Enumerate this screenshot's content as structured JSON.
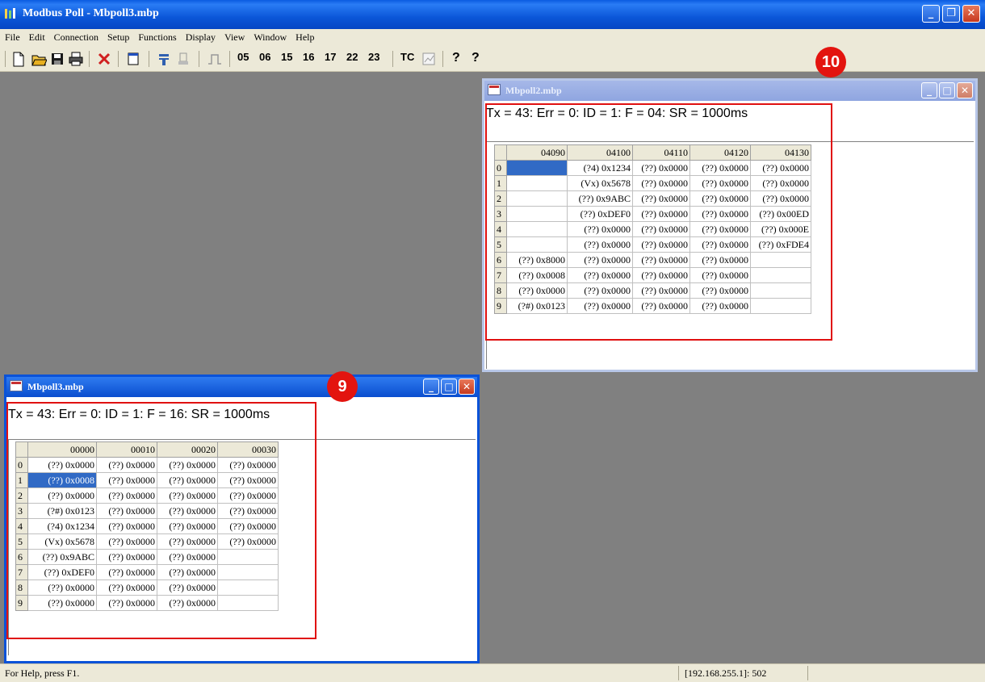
{
  "app": {
    "title": "Modbus Poll - Mbpoll3.mbp",
    "window_buttons": {
      "minimize": "_",
      "restore": "❐",
      "close": "✕"
    }
  },
  "menu": [
    "File",
    "Edit",
    "Connection",
    "Setup",
    "Functions",
    "Display",
    "View",
    "Window",
    "Help"
  ],
  "toolbar": {
    "icons": [
      "new-icon",
      "open-icon",
      "save-icon",
      "print-icon",
      "delete-icon",
      "window-icon",
      "connect-icon",
      "disconnect-icon",
      "pulse-icon"
    ],
    "function_codes": [
      "05",
      "06",
      "15",
      "16",
      "17",
      "22",
      "23"
    ],
    "tc_label": "TC",
    "help_icon": "?",
    "context_help_icon": "?"
  },
  "windows": {
    "mbpoll2": {
      "title": "Mbpoll2.mbp",
      "status": "Tx = 43: Err = 0: ID = 1: F = 04: SR = 1000ms",
      "columns": [
        "04090",
        "04100",
        "04110",
        "04120",
        "04130"
      ],
      "rows": [
        [
          "",
          "(?4) 0x1234",
          "(??) 0x0000",
          "(??) 0x0000",
          "(??) 0x0000"
        ],
        [
          "",
          "(Vx) 0x5678",
          "(??) 0x0000",
          "(??) 0x0000",
          "(??) 0x0000"
        ],
        [
          "",
          "(??) 0x9ABC",
          "(??) 0x0000",
          "(??) 0x0000",
          "(??) 0x0000"
        ],
        [
          "",
          "(??) 0xDEF0",
          "(??) 0x0000",
          "(??) 0x0000",
          "(??) 0x00ED"
        ],
        [
          "",
          "(??) 0x0000",
          "(??) 0x0000",
          "(??) 0x0000",
          "(??) 0x000E"
        ],
        [
          "",
          "(??) 0x0000",
          "(??) 0x0000",
          "(??) 0x0000",
          "(??) 0xFDE4"
        ],
        [
          "(??) 0x8000",
          "(??) 0x0000",
          "(??) 0x0000",
          "(??) 0x0000",
          ""
        ],
        [
          "(??) 0x0008",
          "(??) 0x0000",
          "(??) 0x0000",
          "(??) 0x0000",
          ""
        ],
        [
          "(??) 0x0000",
          "(??) 0x0000",
          "(??) 0x0000",
          "(??) 0x0000",
          ""
        ],
        [
          "(?#) 0x0123",
          "(??) 0x0000",
          "(??) 0x0000",
          "(??) 0x0000",
          ""
        ]
      ],
      "badge": "10"
    },
    "mbpoll3": {
      "title": "Mbpoll3.mbp",
      "status": "Tx = 43: Err = 0: ID = 1: F = 16: SR = 1000ms",
      "columns": [
        "00000",
        "00010",
        "00020",
        "00030"
      ],
      "rows": [
        [
          "(??) 0x0000",
          "(??) 0x0000",
          "(??) 0x0000",
          "(??) 0x0000"
        ],
        [
          "(??) 0x0008",
          "(??) 0x0000",
          "(??) 0x0000",
          "(??) 0x0000"
        ],
        [
          "(??) 0x0000",
          "(??) 0x0000",
          "(??) 0x0000",
          "(??) 0x0000"
        ],
        [
          "(?#) 0x0123",
          "(??) 0x0000",
          "(??) 0x0000",
          "(??) 0x0000"
        ],
        [
          "(?4) 0x1234",
          "(??) 0x0000",
          "(??) 0x0000",
          "(??) 0x0000"
        ],
        [
          "(Vx) 0x5678",
          "(??) 0x0000",
          "(??) 0x0000",
          "(??) 0x0000"
        ],
        [
          "(??) 0x9ABC",
          "(??) 0x0000",
          "(??) 0x0000",
          ""
        ],
        [
          "(??) 0xDEF0",
          "(??) 0x0000",
          "(??) 0x0000",
          ""
        ],
        [
          "(??) 0x0000",
          "(??) 0x0000",
          "(??) 0x0000",
          ""
        ],
        [
          "(??) 0x0000",
          "(??) 0x0000",
          "(??) 0x0000",
          ""
        ]
      ],
      "badge": "9"
    }
  },
  "statusbar": {
    "help": "For Help, press F1.",
    "address": "[192.168.255.1]: 502"
  },
  "colors": {
    "title_blue": "#0a5be0",
    "selection": "#316ac5",
    "annotation_red": "#e01010",
    "mdi_background": "#808080"
  }
}
